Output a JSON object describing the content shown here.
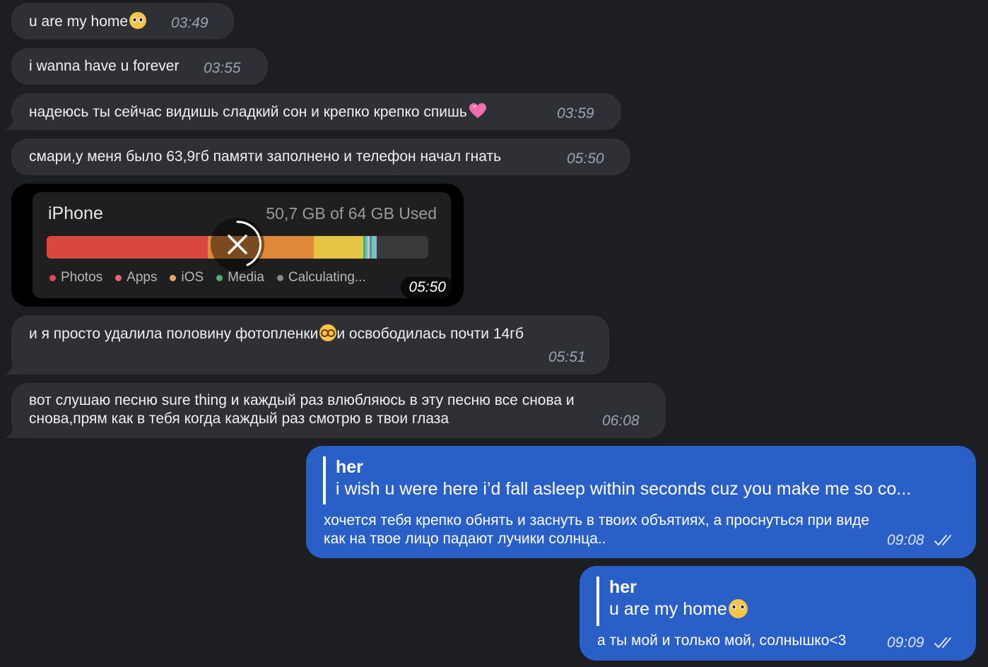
{
  "messages": {
    "m1": {
      "text": "u are my home",
      "time": "03:49"
    },
    "m2": {
      "text": "i wanna have u forever",
      "time": "03:55"
    },
    "m3": {
      "text": "надеюсь ты сейчас видишь сладкий сон и крепко крепко спишь",
      "time": "03:59"
    },
    "m4": {
      "text": "смари,у меня было 63,9гб памяти заполнено и телефон начал гнать",
      "time": "05:50"
    },
    "m5": {
      "time": "05:50",
      "image": {
        "device": "iPhone",
        "used": "50,7 GB of 64 GB Used",
        "legend": [
          "Photos",
          "Apps",
          "iOS",
          "Media",
          "Calculating..."
        ]
      }
    },
    "m6": {
      "text_before": "и я просто удалила половину фотопленки",
      "text_after": "и освободилась почти 14гб",
      "time": "05:51"
    },
    "m7": {
      "line1": "вот слушаю песню sure thing и каждый раз влюбляюсь в эту песню все снова и",
      "line2": "снова,прям как в тебя когда каждый раз смотрю в твои глаза",
      "time": "06:08"
    },
    "m8": {
      "reply_name": "her",
      "reply_text": "i wish u were here i’d fall asleep within seconds cuz you make me so co...",
      "line1": "хочется тебя крепко обнять и заснуть в твоих объятиях, а проснуться при виде",
      "line2": "как на твое лицо падают лучики солнца..",
      "time": "09:08"
    },
    "m9": {
      "reply_name": "her",
      "reply_text": "u are my home",
      "text": "а ты мой и только мой, солнышко<3",
      "time": "09:09"
    }
  },
  "colors": {
    "background": "#1c1e22",
    "incoming_bubble": "#2e3035",
    "outgoing_bubble": "#2a5fc8",
    "storage_photos": "#d9473f",
    "storage_apps": "#e0893a",
    "storage_ios": "#e6c245",
    "storage_media": "#4fae6a"
  },
  "icons": [
    "pleading-face-emoji",
    "pink-heart-emoji",
    "dizzy-face-emoji",
    "cancel-download-icon",
    "double-check-icon"
  ]
}
